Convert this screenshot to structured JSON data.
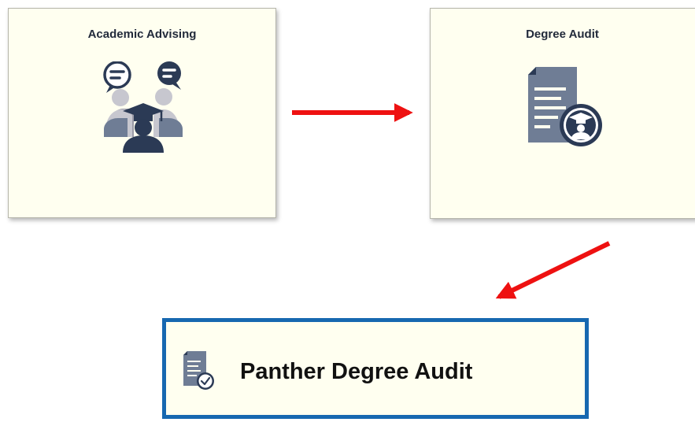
{
  "tiles": [
    {
      "title": "Academic Advising",
      "icon": "academic-advising-icon"
    },
    {
      "title": "Degree Audit",
      "icon": "degree-audit-icon"
    }
  ],
  "link": {
    "label": "Panther Degree Audit",
    "icon": "degree-audit-checked-icon"
  },
  "colors": {
    "tile_background": "#fffff0",
    "tile_border": "#b5b5ab",
    "icon_dark": "#2b3a55",
    "icon_slate": "#6f7d95",
    "icon_light_gray": "#c7c7cf",
    "arrow": "#ee1111",
    "link_border": "#1768b0"
  }
}
